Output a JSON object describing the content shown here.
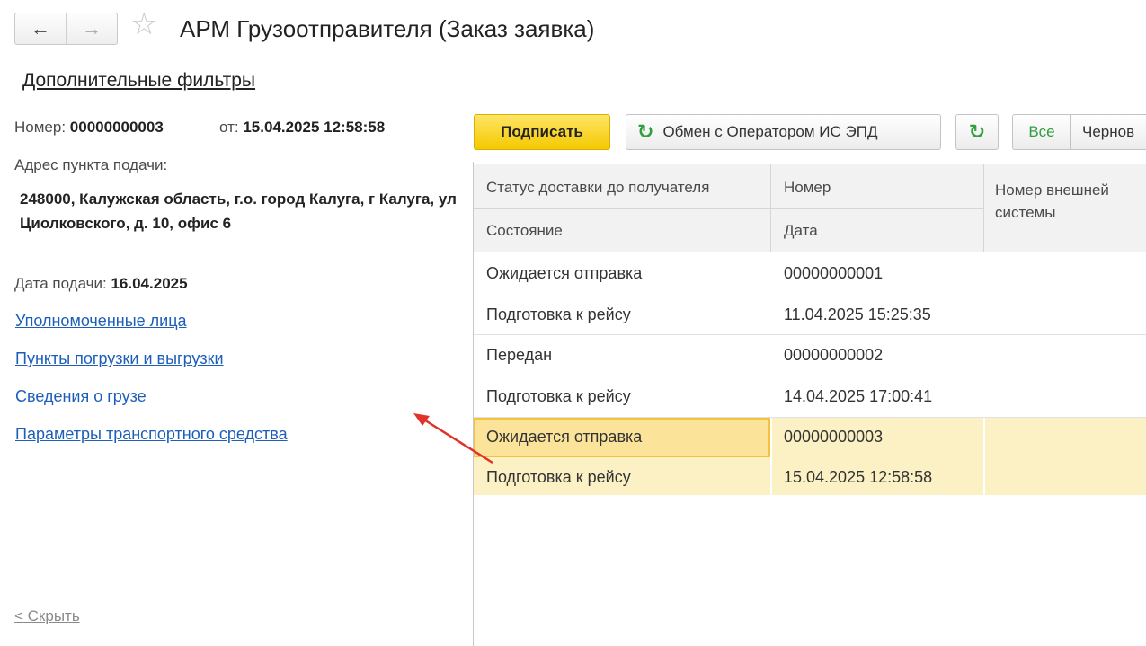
{
  "header": {
    "back_icon": "←",
    "forward_icon": "→",
    "star_icon": "☆",
    "title": "АРМ Грузоотправителя (Заказ заявка)"
  },
  "filters_link": "Дополнительные фильтры",
  "details": {
    "number_label": "Номер:",
    "number_value": "00000000003",
    "from_label": "от:",
    "from_value": "15.04.2025 12:58:58",
    "address_label": "Адрес пункта подачи:",
    "address_value": "248000, Калужская область, г.о. город Калуга, г Калуга, ул Циолковского, д. 10, офис 6",
    "date_label": "Дата подачи:",
    "date_value": "16.04.2025",
    "links": [
      "Уполномоченные лица",
      "Пункты погрузки и выгрузки",
      "Сведения о грузе",
      "Параметры транспортного средства"
    ],
    "hide_link": "< Скрыть"
  },
  "toolbar": {
    "sign_label": "Подписать",
    "exchange_label": "Обмен с Оператором ИС ЭПД",
    "refresh_icon": "↻",
    "filter_all": "Все",
    "filter_drafts": "Чернов"
  },
  "table": {
    "headers": {
      "delivery_status": "Статус доставки до получателя",
      "number": "Номер",
      "external_number": "Номер внешней системы",
      "state": "Состояние",
      "date": "Дата"
    },
    "rows": [
      {
        "delivery_status": "Ожидается отправка",
        "number": "00000000001",
        "state": "Подготовка к рейсу",
        "date": "11.04.2025 15:25:35"
      },
      {
        "delivery_status": "Передан",
        "number": "00000000002",
        "state": "Подготовка к рейсу",
        "date": "14.04.2025 17:00:41"
      },
      {
        "delivery_status": "Ожидается отправка",
        "number": "00000000003",
        "state": "Подготовка к рейсу",
        "date": "15.04.2025 12:58:58"
      }
    ]
  },
  "colors": {
    "accent_yellow": "#f4c900",
    "link_blue": "#1d5fb8",
    "selection_row": "#fcf1c4",
    "annotation_arrow": "#e0342a"
  }
}
